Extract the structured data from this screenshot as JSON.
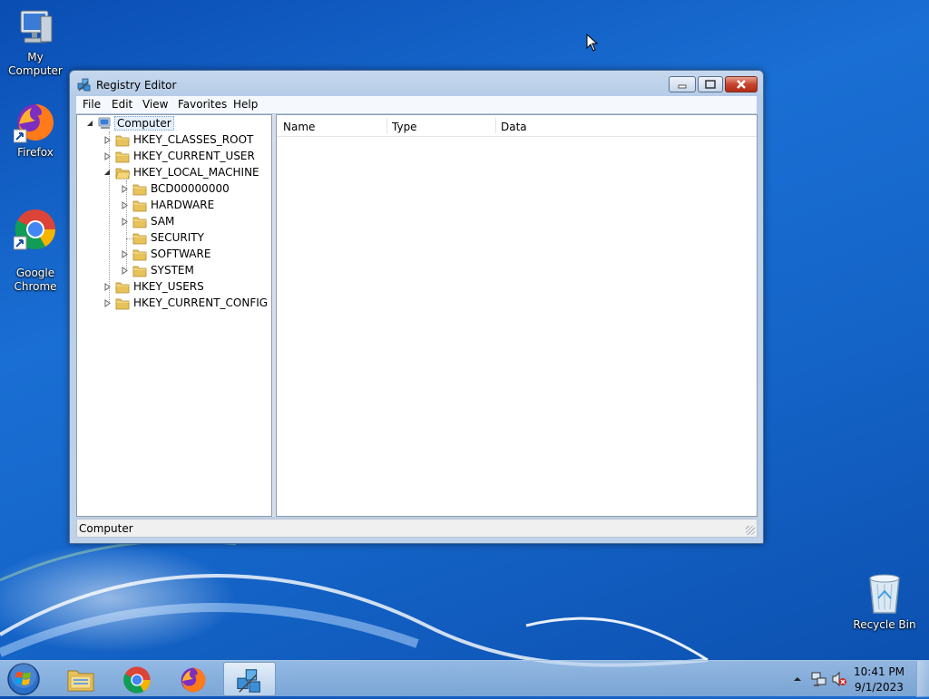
{
  "desktop": {
    "icons": [
      {
        "label": "My Computer"
      },
      {
        "label": "Firefox"
      },
      {
        "label": "Google\nChrome"
      },
      {
        "label": "Recycle Bin"
      }
    ]
  },
  "window": {
    "title": "Registry Editor",
    "menu": [
      "File",
      "Edit",
      "View",
      "Favorites",
      "Help"
    ],
    "tree": {
      "root": "Computer",
      "hives": [
        {
          "label": "HKEY_CLASSES_ROOT",
          "expanded": false
        },
        {
          "label": "HKEY_CURRENT_USER",
          "expanded": false
        },
        {
          "label": "HKEY_LOCAL_MACHINE",
          "expanded": true
        },
        {
          "label": "HKEY_USERS",
          "expanded": false
        },
        {
          "label": "HKEY_CURRENT_CONFIG",
          "expanded": false
        }
      ],
      "local_machine_children": [
        {
          "label": "BCD00000000",
          "has_children": true
        },
        {
          "label": "HARDWARE",
          "has_children": true
        },
        {
          "label": "SAM",
          "has_children": true
        },
        {
          "label": "SECURITY",
          "has_children": false
        },
        {
          "label": "SOFTWARE",
          "has_children": true
        },
        {
          "label": "SYSTEM",
          "has_children": true
        }
      ]
    },
    "columns": [
      "Name",
      "Type",
      "Data"
    ],
    "status": "Computer"
  },
  "taskbar": {
    "clock_time": "10:41 PM",
    "clock_date": "9/1/2023"
  },
  "colors": {
    "desktop_blue": "#1565c9",
    "window_frame": "#c6d8ee",
    "close_red": "#c6452e",
    "folder_yellow": "#e8c25a"
  }
}
